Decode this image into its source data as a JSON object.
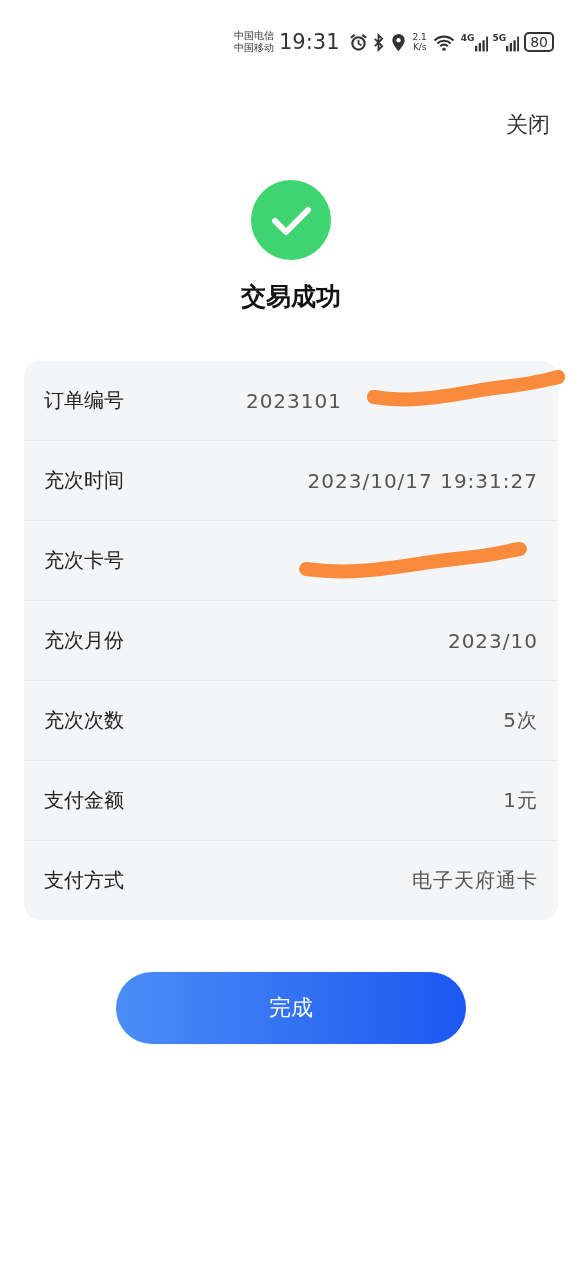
{
  "status_bar": {
    "carriers": [
      "中国电信",
      "中国移动"
    ],
    "time": "19:31",
    "speed": [
      "2.1",
      "K/s"
    ],
    "networks": [
      "4G",
      "5G"
    ],
    "battery": "80"
  },
  "close": "关闭",
  "result": {
    "title": "交易成功",
    "success": true
  },
  "details": [
    {
      "label": "订单编号",
      "value": "2023101",
      "redacted": true
    },
    {
      "label": "充次时间",
      "value": "2023/10/17 19:31:27",
      "redacted": false
    },
    {
      "label": "充次卡号",
      "redacted": true
    },
    {
      "label": "充次月份",
      "value": "2023/10",
      "redacted": false
    },
    {
      "label": "充次次数",
      "value": "5次",
      "redacted": false
    },
    {
      "label": "支付金额",
      "value": "1元",
      "redacted": false
    },
    {
      "label": "支付方式",
      "value": "电子天府通卡",
      "redacted": false
    }
  ],
  "done_button": "完成"
}
